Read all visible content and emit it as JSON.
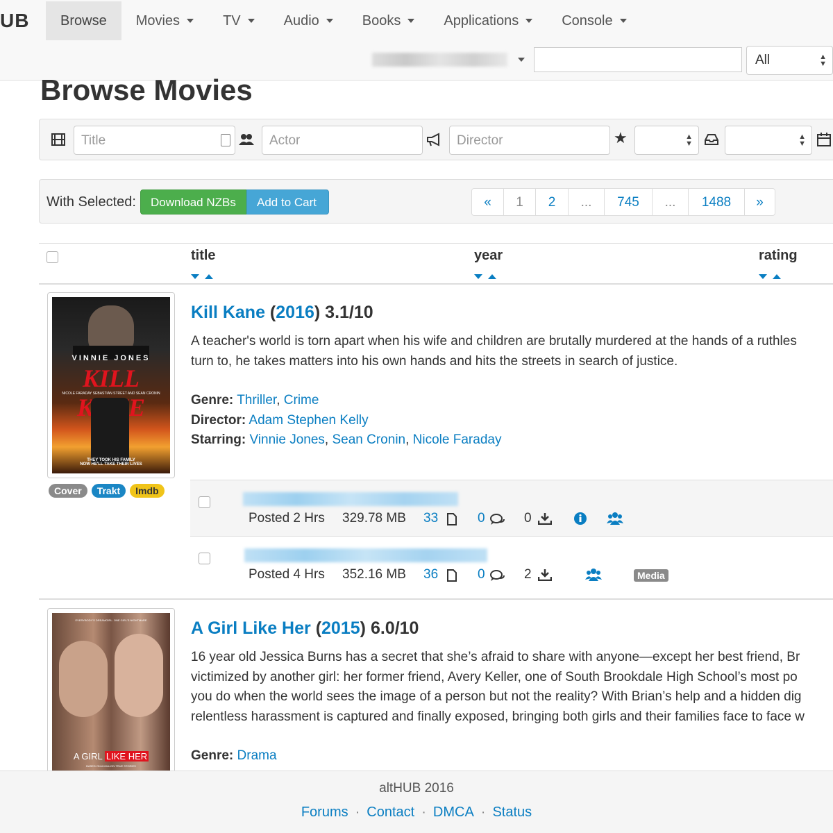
{
  "navbar": {
    "brand": "UB",
    "items": [
      {
        "label": "Browse"
      },
      {
        "label": "Movies"
      },
      {
        "label": "TV"
      },
      {
        "label": "Audio"
      },
      {
        "label": "Books"
      },
      {
        "label": "Applications"
      },
      {
        "label": "Console"
      }
    ],
    "search_value": "",
    "search_category": "All"
  },
  "page": {
    "title": "Browse Movies"
  },
  "filters": {
    "title_placeholder": "Title",
    "actor_placeholder": "Actor",
    "director_placeholder": "Director",
    "rating_value": "",
    "genre_value": ""
  },
  "actions": {
    "with_selected": "With Selected:",
    "download_label": "Download NZBs",
    "cart_label": "Add to Cart"
  },
  "pagination": [
    "«",
    "1",
    "2",
    "...",
    "745",
    "...",
    "1488",
    "»"
  ],
  "columns": {
    "title": "title",
    "year": "year",
    "rating": "rating"
  },
  "colors": {
    "link": "#0a7ec2",
    "green": "#4cae4c",
    "blue": "#46a6d6",
    "imdb": "#f0c419",
    "cover": "#8a8a8a"
  },
  "movies": [
    {
      "title": "Kill Kane",
      "year": "2016",
      "rating": "3.1/10",
      "plot_lines": [
        "A teacher's world is torn apart when his wife and children are brutally murdered at the hands of a ruthles",
        "turn to, he takes matters into his own hands and hits the streets in search of justice."
      ],
      "genre_label": "Genre:",
      "genres": [
        "Thriller",
        "Crime"
      ],
      "director_label": "Director:",
      "director": "Adam Stephen Kelly",
      "starring_label": "Starring:",
      "starring": [
        "Vinnie Jones",
        "Sean Cronin",
        "Nicole Faraday"
      ],
      "poster": {
        "actor": "VINNIE JONES",
        "title": "KILL KANE",
        "credits": "NICOLE FARADAY  SEBASTIAN STREET  AND SEAN CRONIN",
        "tagline1": "THEY TOOK HIS FAMILY",
        "tagline2": "NOW HE'LL TAKE THEIR LIVES"
      },
      "badges": [
        "Cover",
        "Trakt",
        "Imdb"
      ],
      "releases": [
        {
          "posted": "Posted 2 Hrs",
          "size": "329.78 MB",
          "files": "33",
          "comments": "0",
          "grabs": "0"
        },
        {
          "posted": "Posted 4 Hrs",
          "size": "352.16 MB",
          "files": "36",
          "comments": "0",
          "grabs": "2",
          "tag": "Media"
        }
      ]
    },
    {
      "title": "A Girl Like Her",
      "year": "2015",
      "rating": "6.0/10",
      "plot_lines": [
        "16 year old Jessica Burns has a secret that she’s afraid to share with anyone—except her best friend, Br",
        "victimized by another girl: her former friend, Avery Keller, one of South Brookdale High School’s most po",
        "you do when the world sees the image of a person but not the reality? With Brian’s help and a hidden dig",
        "relentless harassment is captured and finally exposed, bringing both girls and their families face to face w"
      ],
      "genre_label": "Genre:",
      "genres": [
        "Drama"
      ],
      "poster": {
        "top_text": "EVERYBODY'S DREAMGIRL. ONE GIRL'S NIGHTMARE",
        "title_a": "A GIRL",
        "title_b": "LIKE HER",
        "sub": "BASED ON A MILLION TRUE STORIES"
      }
    }
  ],
  "footer": {
    "copyright": "altHUB 2016",
    "links": [
      "Forums",
      "Contact",
      "DMCA",
      "Status"
    ]
  }
}
